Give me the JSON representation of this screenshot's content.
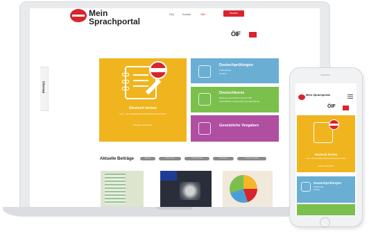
{
  "header": {
    "logo_line1": "Mein",
    "logo_line2": "Sprachportal",
    "nav": [
      "FAQ",
      "Kontakt",
      "Hilfe",
      "Suchen"
    ],
    "active_nav": "Hilfe",
    "cta": "Suchen",
    "partner": "ÖIF"
  },
  "sidebar": {
    "sitemap_label": "Sitemap"
  },
  "tiles": [
    {
      "title": "Deutsch lernen",
      "subtitle": "Lern- und unterstützende Deutschlernen für Kinder",
      "extra": "Deutsch unterrichten",
      "color": "#f0b41e"
    },
    {
      "title": "Deutschprüfungen",
      "subtitle": "Vorbereitung",
      "extra": "Termine",
      "color": "#6aaed3"
    },
    {
      "title": "Deutschkurse",
      "subtitle": "Beratung und Förderung durch ÖIF",
      "extra": "Kursanbieter in Österreich und international",
      "color": "#7bbf4d"
    },
    {
      "title": "Gesetzliche Vorgaben",
      "subtitle": "",
      "extra": "",
      "color": "#b04ea1"
    }
  ],
  "posts": {
    "title": "Aktuelle Beiträge",
    "filters": [
      "Allgemein",
      "Deutsch lernen",
      "Deutschprüfungen",
      "Deutschkurse",
      "Gesetzliche Vorgaben"
    ]
  },
  "phone": {
    "logo": "Mein Sprachportal",
    "partner": "ÖIF",
    "tile1_title": "Deutsch lernen",
    "tile1_sub": "Lern- und unterstützende Deutschlernen für Kinder",
    "tile1_extra": "Deutsch unterrichten",
    "tile2_title": "Deutschprüfungen",
    "tile2_sub": "Vorbereitung",
    "tile2_extra": "Termine"
  },
  "colors": {
    "brand_red": "#d9232d",
    "yellow": "#f0b41e",
    "blue": "#6aaed3",
    "green": "#7bbf4d",
    "purple": "#b04ea1"
  }
}
